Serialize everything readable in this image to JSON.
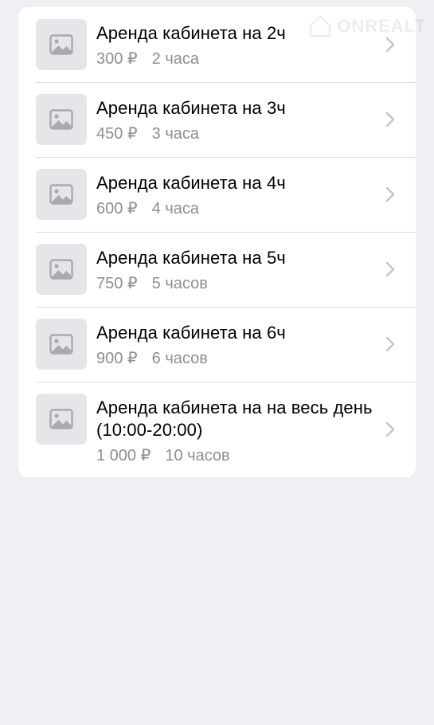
{
  "icons": {
    "thumbnail": "image-placeholder-icon",
    "chevron": "chevron-right-icon",
    "watermark": "house-logo-icon"
  },
  "watermark": {
    "text": "ONREALT"
  },
  "items": [
    {
      "title": "Аренда кабинета на 2ч",
      "price": "300 ₽",
      "duration": "2 часа"
    },
    {
      "title": "Аренда кабинета на 3ч",
      "price": "450 ₽",
      "duration": "3 часа"
    },
    {
      "title": "Аренда кабинета на 4ч",
      "price": "600 ₽",
      "duration": "4 часа"
    },
    {
      "title": "Аренда кабинета на 5ч",
      "price": "750 ₽",
      "duration": "5 часов"
    },
    {
      "title": "Аренда кабинета на 6ч",
      "price": "900 ₽",
      "duration": "6 часов"
    },
    {
      "title": "Аренда кабинета на на весь день (10:00-20:00)",
      "price": "1 000 ₽",
      "duration": "10 часов"
    }
  ]
}
